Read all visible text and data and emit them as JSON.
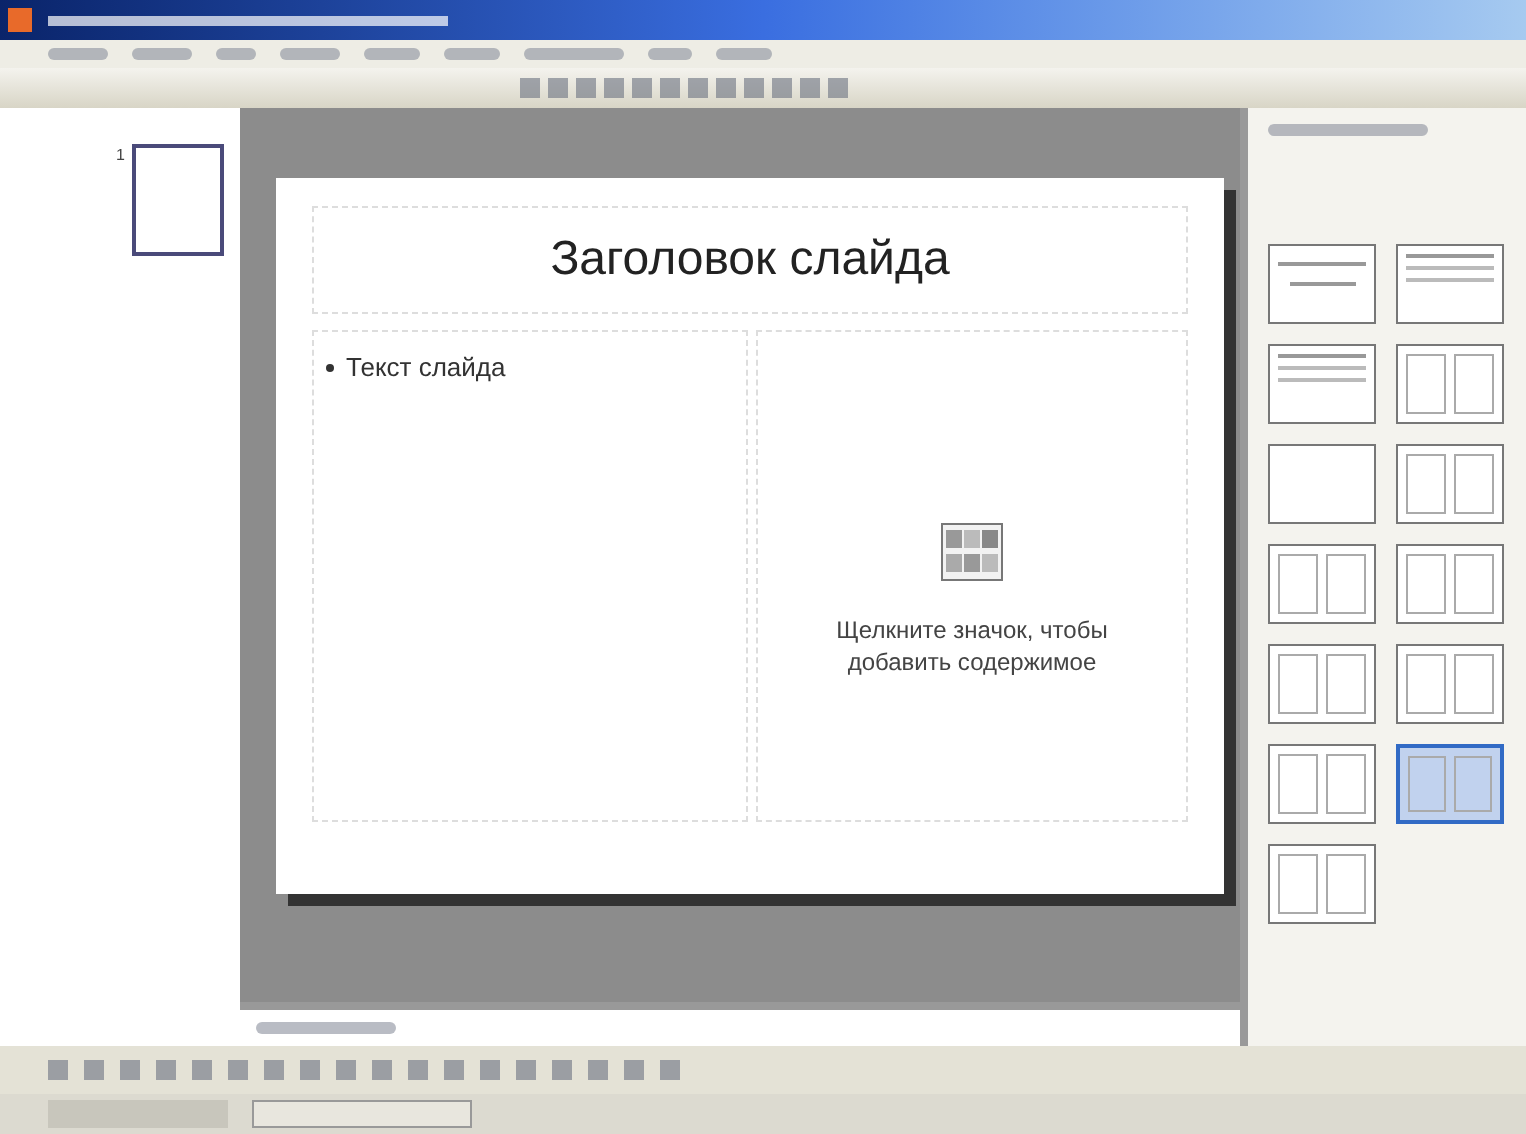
{
  "slides_panel": {
    "thumbnails": [
      {
        "number": "1",
        "selected": true
      }
    ]
  },
  "slide": {
    "title": "Заголовок слайда",
    "bullets": [
      "Текст слайда"
    ],
    "content_hint": "Щелкните значок, чтобы добавить содержимое"
  },
  "layouts_pane": {
    "layouts": [
      {
        "kind": "title",
        "selected": false
      },
      {
        "kind": "text",
        "selected": false
      },
      {
        "kind": "text",
        "selected": false
      },
      {
        "kind": "two",
        "selected": false
      },
      {
        "kind": "blank",
        "selected": false
      },
      {
        "kind": "two",
        "selected": false
      },
      {
        "kind": "two",
        "selected": false
      },
      {
        "kind": "two",
        "selected": false
      },
      {
        "kind": "two",
        "selected": false
      },
      {
        "kind": "two",
        "selected": false
      },
      {
        "kind": "two",
        "selected": false
      },
      {
        "kind": "two",
        "selected": true
      },
      {
        "kind": "two",
        "selected": false
      }
    ]
  }
}
